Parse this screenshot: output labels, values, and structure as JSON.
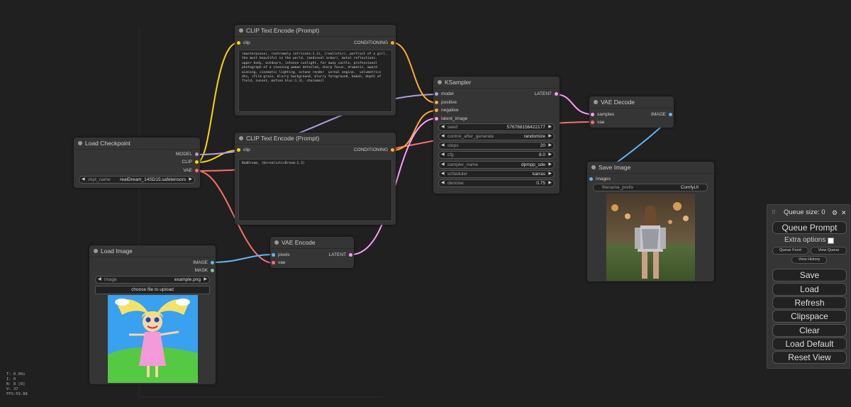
{
  "canvas": {
    "stats": [
      "T: 0.00s",
      "I: 0",
      "N: 8 [8]",
      "V: 37",
      "FPS:59.88"
    ]
  },
  "colors": {
    "background": "#202020",
    "node": "#353535",
    "clip_wire": "#FFD500",
    "conditioning_wire": "#FFA931",
    "model_wire": "#B39DDB",
    "vae_wire": "#FF6E6E",
    "latent_wire": "#FF9CF9",
    "image_wire": "#64B5F6",
    "mask_wire": "#81C784"
  },
  "nodes": {
    "clip_top": {
      "title": "CLIP Text Encode (Prompt)",
      "input": "clip",
      "output": "CONDITIONING",
      "text": "(masterpiece), (extremely intricate:1.3), (realistic), portrait of a girl, the most beautiful in the world, (medieval armor), metal reflections, upper body, outdoors, intense sunlight, far away castle, professional photograph of a stunning woman detailed, sharp focus, dramatic, award winning, cinematic lighting, octane render  unreal engine,  volumetrics dtx, (film grain, blurry background, blurry foreground, bokeh, depth of field, sunset, motion blur:1.3), chainmail"
    },
    "clip_bottom": {
      "title": "CLIP Text Encode (Prompt)",
      "input": "clip",
      "output": "CONDITIONING",
      "text": "BadDream, (UnrealisticDream:1.3)"
    },
    "load_checkpoint": {
      "title": "Load Checkpoint",
      "outputs": [
        "MODEL",
        "CLIP",
        "VAE"
      ],
      "ckpt_label": "ckpt_name",
      "ckpt_value": "realDream_14SD15.safetensors"
    },
    "ksampler": {
      "title": "KSampler",
      "inputs": [
        "model",
        "positive",
        "negative",
        "latent_image"
      ],
      "output": "LATENT",
      "widgets": [
        {
          "label": "seed",
          "value": "576788156422177"
        },
        {
          "label": "control_after_generate",
          "value": "randomize"
        },
        {
          "label": "steps",
          "value": "20"
        },
        {
          "label": "cfg",
          "value": "8.0"
        },
        {
          "label": "sampler_name",
          "value": "dpmpp_sde"
        },
        {
          "label": "scheduler",
          "value": "karras"
        },
        {
          "label": "denoise",
          "value": "0.75"
        }
      ]
    },
    "vae_decode": {
      "title": "VAE Decode",
      "inputs": [
        "samples",
        "vae"
      ],
      "output": "IMAGE"
    },
    "save_image": {
      "title": "Save Image",
      "input": "images",
      "prefix_label": "filename_prefix",
      "prefix_value": "ComfyUI"
    },
    "vae_encode": {
      "title": "VAE Encode",
      "inputs": [
        "pixels",
        "vae"
      ],
      "output": "LATENT"
    },
    "load_image": {
      "title": "Load Image",
      "outputs": [
        "IMAGE",
        "MASK"
      ],
      "image_label": "image",
      "image_value": "example.png",
      "upload_label": "choose file to upload"
    }
  },
  "menu": {
    "queue_size": "Queue size: 0",
    "queue_prompt": "Queue Prompt",
    "extra_options": "Extra options",
    "queue_front": "Queue Front",
    "view_queue": "View Queue",
    "view_history": "View History",
    "buttons": [
      "Save",
      "Load",
      "Refresh",
      "Clipspace",
      "Clear",
      "Load Default",
      "Reset View"
    ]
  }
}
